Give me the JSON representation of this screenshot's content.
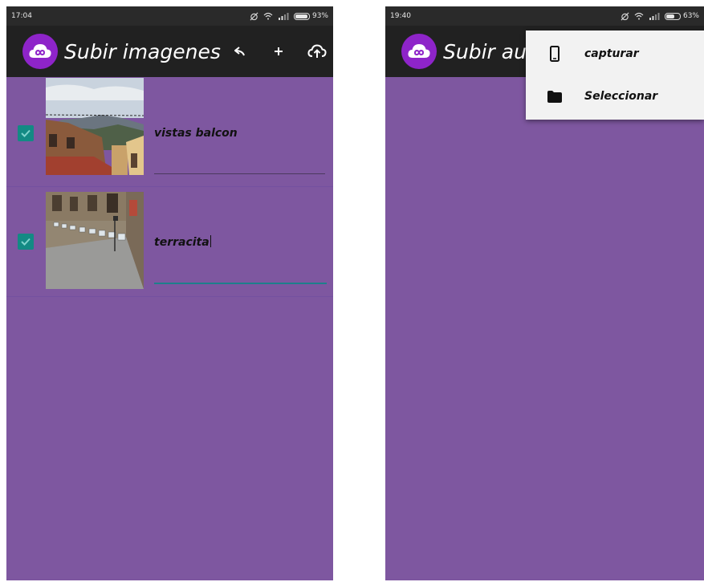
{
  "left_screen": {
    "status_bar": {
      "time": "17:04",
      "battery": "93%",
      "battery_level": 0.93
    },
    "app_bar": {
      "title": "Subir imagenes",
      "actions": [
        {
          "icon": "back-arrow-icon"
        },
        {
          "icon": "plus-icon"
        },
        {
          "icon": "cloud-upload-icon"
        }
      ]
    },
    "items": [
      {
        "checked": true,
        "thumbnail": "mountain-village-balcony-view",
        "caption": "vistas balcon",
        "focused": false
      },
      {
        "checked": true,
        "thumbnail": "street-terrace-tables",
        "caption": "terracita",
        "focused": true
      }
    ]
  },
  "right_screen": {
    "status_bar": {
      "time": "19:40",
      "battery": "63%",
      "battery_level": 0.63
    },
    "app_bar": {
      "title": "Subir aud"
    },
    "menu": {
      "items": [
        {
          "icon": "phone-icon",
          "label": "capturar"
        },
        {
          "icon": "folder-icon",
          "label": "Seleccionar"
        }
      ]
    }
  },
  "colors": {
    "background": "#7e57a0",
    "app_bar": "#212121",
    "logo": "#8e24c9",
    "checkbox": "#138a84",
    "menu": "#f2f2f2"
  }
}
